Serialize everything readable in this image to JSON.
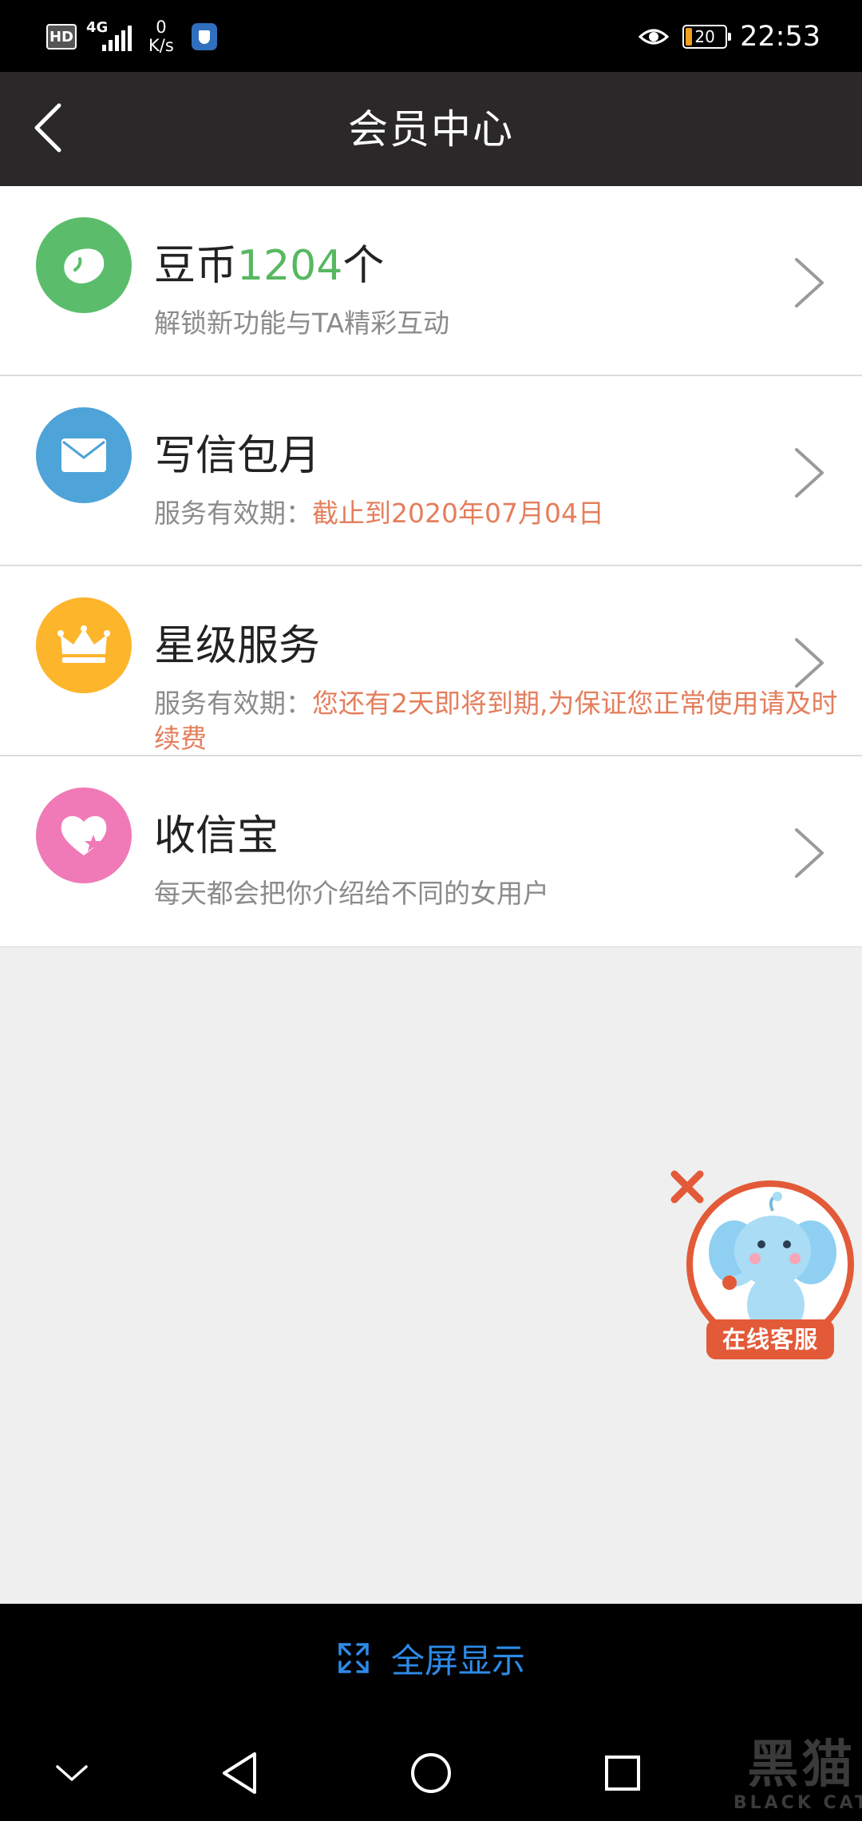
{
  "status_bar": {
    "hd_label": "HD",
    "network_type": "4G",
    "speed_value": "0",
    "speed_unit": "K/s",
    "battery_level": "20",
    "time": "22:53"
  },
  "header": {
    "title": "会员中心"
  },
  "items": [
    {
      "title_prefix": "豆币",
      "title_value": "1204",
      "title_suffix": "个",
      "subtitle": "解锁新功能与TA精彩互动",
      "icon": "bean-icon",
      "color": "#5bbd6c"
    },
    {
      "title": "写信包月",
      "subtitle_label": "服务有效期：",
      "subtitle_value": "截止到2020年07月04日",
      "icon": "mail-icon",
      "color": "#4ea3d8"
    },
    {
      "title": "星级服务",
      "subtitle_label": "服务有效期：",
      "subtitle_value": "您还有2天即将到期,为保证您正常使用请及时续费",
      "icon": "crown-icon",
      "color": "#fdb52c"
    },
    {
      "title": "收信宝",
      "subtitle": "每天都会把你介绍给不同的女用户",
      "icon": "heart-star-icon",
      "color": "#f07ab8"
    }
  ],
  "customer_service": {
    "label": "在线客服"
  },
  "bottom": {
    "fullscreen_label": "全屏显示"
  },
  "watermark": {
    "cn": "黑猫",
    "en": "BLACK CAT"
  },
  "colors": {
    "header_bg": "#2b2829",
    "accent_orange": "#e47e5c",
    "accent_green": "#57b85f",
    "link_blue": "#2d8be8"
  }
}
